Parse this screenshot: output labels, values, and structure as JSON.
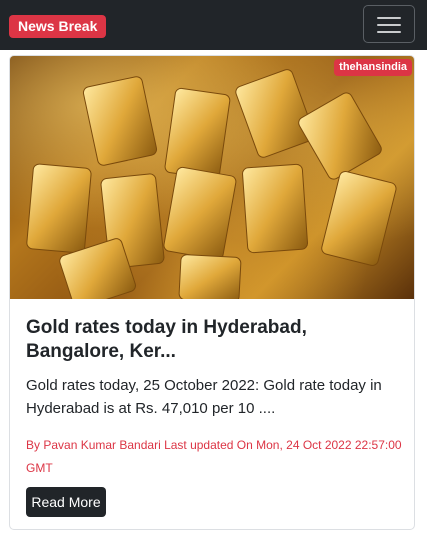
{
  "navbar": {
    "brand": "News Break",
    "menu_icon": "hamburger-menu-icon"
  },
  "article": {
    "image_alt": "Gold bars",
    "source": "thehansindia",
    "title": "Gold rates today in Hyderabad, Bangalore, Ker...",
    "summary": "Gold rates today, 25 October 2022: Gold rate today in Hyderabad is at Rs. 47,010 per 10 ....",
    "meta": "By Pavan Kumar Bandari Last updated On Mon, 24 Oct 2022 22:57:00 GMT",
    "read_more_label": "Read More"
  },
  "colors": {
    "navbar_bg": "#212529",
    "accent_red": "#dc3545",
    "button_dark": "#212529"
  }
}
